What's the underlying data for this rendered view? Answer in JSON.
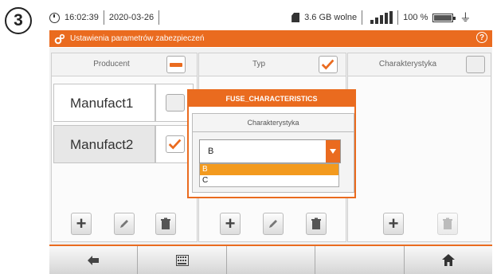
{
  "step": "3",
  "status": {
    "time": "16:02:39",
    "date": "2020-03-26",
    "storage": "3.6 GB wolne",
    "battery": "100 %"
  },
  "title": "Ustawienia parametrów zabezpieczeń",
  "help_symbol": "?",
  "columns": {
    "producer": {
      "header": "Producent",
      "header_check": "minus",
      "rows": [
        {
          "name": "Manufact1",
          "checked": false
        },
        {
          "name": "Manufact2",
          "checked": true
        }
      ]
    },
    "type": {
      "header": "Typ",
      "header_check": "checked"
    },
    "characteristic": {
      "header": "Charakterystyka",
      "header_check": "unchecked"
    }
  },
  "dialog": {
    "title": "FUSE_CHARACTERISTICS",
    "subtitle": "Charakterystyka",
    "selected_value": "B",
    "options": [
      "B",
      "C"
    ],
    "highlighted_option": "B"
  },
  "toolbar_icons": [
    "plus-icon",
    "pencil-icon",
    "trash-icon"
  ],
  "bottom_icons": [
    "back-arrow-icon",
    "keyboard-icon",
    "home-icon"
  ],
  "colors": {
    "accent": "#ea6b1f",
    "option_highlight": "#f39a1e"
  }
}
